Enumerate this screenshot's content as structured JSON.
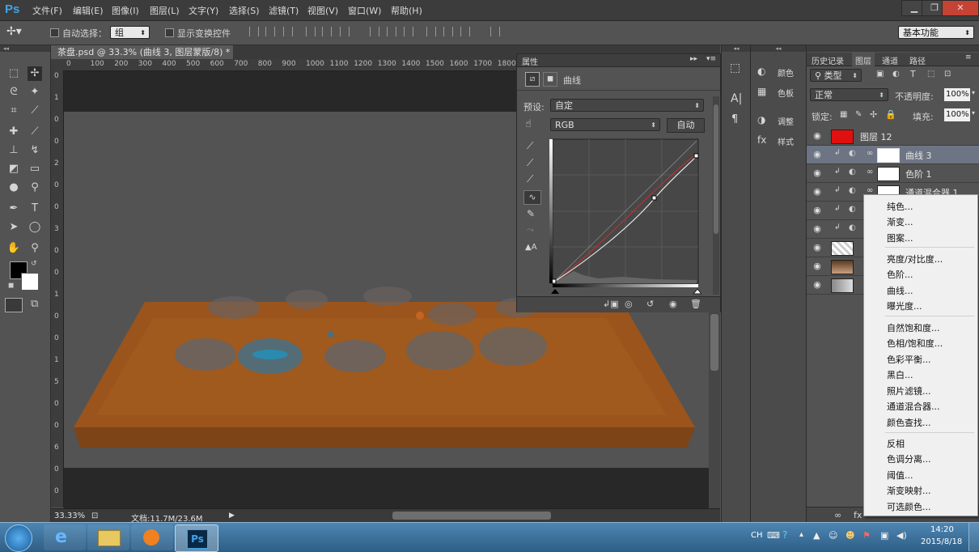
{
  "app": {
    "logo": "Ps"
  },
  "menu": [
    "文件(F)",
    "编辑(E)",
    "图像(I)",
    "图层(L)",
    "文字(Y)",
    "选择(S)",
    "滤镜(T)",
    "视图(V)",
    "窗口(W)",
    "帮助(H)"
  ],
  "window_controls": {
    "minimize": "▁",
    "restore": "❐",
    "close": "✕"
  },
  "options_bar": {
    "auto_select_label": "自动选择：",
    "auto_select_value": "组",
    "show_transform_label": "显示变换控件",
    "workspace": "基本功能"
  },
  "document": {
    "tab_title": "茶盘.psd @ 33.3% (曲线 3, 图层蒙版/8) *",
    "tab_close": "×",
    "ruler_top": [
      "0",
      "100",
      "200",
      "300",
      "400",
      "500",
      "600",
      "700",
      "800",
      "900",
      "1000",
      "1100",
      "1200",
      "1300",
      "1400",
      "1500",
      "1600",
      "1700",
      "1800"
    ],
    "ruler_left": [
      "0",
      "1",
      "0",
      "0",
      "2",
      "0",
      "0",
      "3",
      "0",
      "0",
      "1",
      "0",
      "0",
      "1",
      "5",
      "0",
      "0",
      "6",
      "0",
      "0"
    ],
    "zoom": "33.33%",
    "doc_size": "文档:11.7M/23.6M"
  },
  "properties": {
    "panel_title": "属性",
    "adjustment_name": "曲线",
    "preset_label": "预设:",
    "preset_value": "自定",
    "channel_value": "RGB",
    "auto_button": "自动"
  },
  "mini_panels": {
    "color": "颜色",
    "swatches": "色板",
    "adjustments": "调整",
    "styles": "样式"
  },
  "layers_panel": {
    "tabs": [
      "历史记录",
      "图层",
      "通道",
      "路径"
    ],
    "active_tab": "图层",
    "filter_kind": "类型",
    "blend_mode": "正常",
    "opacity_label": "不透明度:",
    "opacity_value": "100%",
    "lock_label": "锁定:",
    "fill_label": "填充:",
    "fill_value": "100%",
    "layers": [
      {
        "name": "图层 12",
        "thumb_color": "#e01010"
      },
      {
        "name": "曲线 3",
        "thumb_color": "#ffffff"
      },
      {
        "name": "色阶 1",
        "thumb_color": "#ffffff"
      },
      {
        "name": "通道混合器 1",
        "thumb_color": "#ffffff"
      }
    ]
  },
  "context_menu": {
    "group1": [
      "纯色...",
      "渐变...",
      "图案..."
    ],
    "group2": [
      "亮度/对比度...",
      "色阶...",
      "曲线...",
      "曝光度..."
    ],
    "group3": [
      "自然饱和度...",
      "色相/饱和度...",
      "色彩平衡...",
      "黑白...",
      "照片滤镜...",
      "通道混合器...",
      "颜色查找..."
    ],
    "group4": [
      "反相",
      "色调分离...",
      "阈值...",
      "渐变映射...",
      "可选颜色..."
    ]
  },
  "taskbar": {
    "ime": "CH",
    "time": "14:20",
    "date": "2015/8/18"
  },
  "colors": {
    "canvas_bg": "#282828",
    "image_bg": "#535353",
    "tray_orange": "#a0581c",
    "cup_blue": "#4b6e80",
    "layer12_red": "#e01010"
  }
}
